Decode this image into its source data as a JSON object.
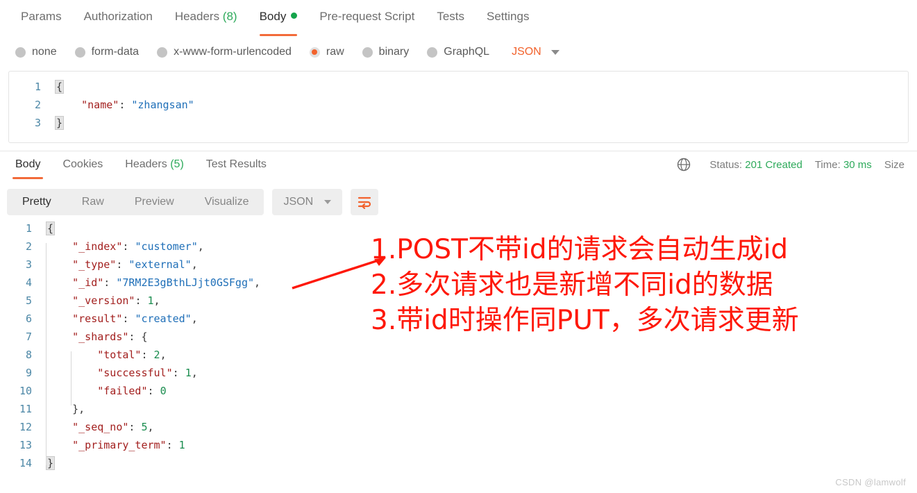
{
  "request_tabs": [
    {
      "label": "Params",
      "count": "",
      "active": false,
      "dot": false
    },
    {
      "label": "Authorization",
      "count": "",
      "active": false,
      "dot": false
    },
    {
      "label": "Headers",
      "count": "(8)",
      "active": false,
      "dot": false
    },
    {
      "label": "Body",
      "count": "",
      "active": true,
      "dot": true
    },
    {
      "label": "Pre-request Script",
      "count": "",
      "active": false,
      "dot": false
    },
    {
      "label": "Tests",
      "count": "",
      "active": false,
      "dot": false
    },
    {
      "label": "Settings",
      "count": "",
      "active": false,
      "dot": false
    }
  ],
  "body_types": {
    "options": [
      {
        "label": "none",
        "selected": false
      },
      {
        "label": "form-data",
        "selected": false
      },
      {
        "label": "x-www-form-urlencoded",
        "selected": false
      },
      {
        "label": "raw",
        "selected": true
      },
      {
        "label": "binary",
        "selected": false
      },
      {
        "label": "GraphQL",
        "selected": false
      }
    ],
    "format": "JSON",
    "format_color": "#f2622c"
  },
  "request_body": {
    "lines": [
      {
        "n": "1",
        "tokens": [
          {
            "t": "{",
            "c": "brace"
          }
        ]
      },
      {
        "n": "2",
        "tokens": [
          {
            "t": "    ",
            "c": "punc"
          },
          {
            "t": "\"name\"",
            "c": "key"
          },
          {
            "t": ": ",
            "c": "punc"
          },
          {
            "t": "\"zhangsan\"",
            "c": "str"
          }
        ]
      },
      {
        "n": "3",
        "tokens": [
          {
            "t": "}",
            "c": "brace"
          }
        ]
      }
    ]
  },
  "response_tabs": [
    {
      "label": "Body",
      "count": "",
      "active": true
    },
    {
      "label": "Cookies",
      "count": "",
      "active": false
    },
    {
      "label": "Headers",
      "count": "(5)",
      "active": false
    },
    {
      "label": "Test Results",
      "count": "",
      "active": false
    }
  ],
  "response_status": {
    "status_label": "Status:",
    "status_value": "201 Created",
    "time_label": "Time:",
    "time_value": "30 ms",
    "size_label": "Size",
    "globe_icon": "globe-icon"
  },
  "response_toolbar": {
    "views": [
      {
        "label": "Pretty",
        "active": true
      },
      {
        "label": "Raw",
        "active": false
      },
      {
        "label": "Preview",
        "active": false
      },
      {
        "label": "Visualize",
        "active": false
      }
    ],
    "format": "JSON",
    "wrap_icon": "word-wrap-icon"
  },
  "response_body": {
    "lines": [
      {
        "n": "1",
        "tokens": [
          {
            "t": "{",
            "c": "brace"
          }
        ]
      },
      {
        "n": "2",
        "tokens": [
          {
            "t": "    ",
            "c": "punc"
          },
          {
            "t": "\"_index\"",
            "c": "key"
          },
          {
            "t": ": ",
            "c": "punc"
          },
          {
            "t": "\"customer\"",
            "c": "str"
          },
          {
            "t": ",",
            "c": "punc"
          }
        ]
      },
      {
        "n": "3",
        "tokens": [
          {
            "t": "    ",
            "c": "punc"
          },
          {
            "t": "\"_type\"",
            "c": "key"
          },
          {
            "t": ": ",
            "c": "punc"
          },
          {
            "t": "\"external\"",
            "c": "str"
          },
          {
            "t": ",",
            "c": "punc"
          }
        ]
      },
      {
        "n": "4",
        "tokens": [
          {
            "t": "    ",
            "c": "punc"
          },
          {
            "t": "\"_id\"",
            "c": "key"
          },
          {
            "t": ": ",
            "c": "punc"
          },
          {
            "t": "\"7RM2E3gBthLJjt0GSFgg\"",
            "c": "str"
          },
          {
            "t": ",",
            "c": "punc"
          }
        ]
      },
      {
        "n": "5",
        "tokens": [
          {
            "t": "    ",
            "c": "punc"
          },
          {
            "t": "\"_version\"",
            "c": "key"
          },
          {
            "t": ": ",
            "c": "punc"
          },
          {
            "t": "1",
            "c": "num"
          },
          {
            "t": ",",
            "c": "punc"
          }
        ]
      },
      {
        "n": "6",
        "tokens": [
          {
            "t": "    ",
            "c": "punc"
          },
          {
            "t": "\"result\"",
            "c": "key"
          },
          {
            "t": ": ",
            "c": "punc"
          },
          {
            "t": "\"created\"",
            "c": "str"
          },
          {
            "t": ",",
            "c": "punc"
          }
        ]
      },
      {
        "n": "7",
        "tokens": [
          {
            "t": "    ",
            "c": "punc"
          },
          {
            "t": "\"_shards\"",
            "c": "key"
          },
          {
            "t": ": {",
            "c": "punc"
          }
        ]
      },
      {
        "n": "8",
        "tokens": [
          {
            "t": "        ",
            "c": "punc"
          },
          {
            "t": "\"total\"",
            "c": "key"
          },
          {
            "t": ": ",
            "c": "punc"
          },
          {
            "t": "2",
            "c": "num"
          },
          {
            "t": ",",
            "c": "punc"
          }
        ]
      },
      {
        "n": "9",
        "tokens": [
          {
            "t": "        ",
            "c": "punc"
          },
          {
            "t": "\"successful\"",
            "c": "key"
          },
          {
            "t": ": ",
            "c": "punc"
          },
          {
            "t": "1",
            "c": "num"
          },
          {
            "t": ",",
            "c": "punc"
          }
        ]
      },
      {
        "n": "10",
        "tokens": [
          {
            "t": "        ",
            "c": "punc"
          },
          {
            "t": "\"failed\"",
            "c": "key"
          },
          {
            "t": ": ",
            "c": "punc"
          },
          {
            "t": "0",
            "c": "num"
          }
        ]
      },
      {
        "n": "11",
        "tokens": [
          {
            "t": "    },",
            "c": "punc"
          }
        ]
      },
      {
        "n": "12",
        "tokens": [
          {
            "t": "    ",
            "c": "punc"
          },
          {
            "t": "\"_seq_no\"",
            "c": "key"
          },
          {
            "t": ": ",
            "c": "punc"
          },
          {
            "t": "5",
            "c": "num"
          },
          {
            "t": ",",
            "c": "punc"
          }
        ]
      },
      {
        "n": "13",
        "tokens": [
          {
            "t": "    ",
            "c": "punc"
          },
          {
            "t": "\"_primary_term\"",
            "c": "key"
          },
          {
            "t": ": ",
            "c": "punc"
          },
          {
            "t": "1",
            "c": "num"
          }
        ]
      },
      {
        "n": "14",
        "tokens": [
          {
            "t": "}",
            "c": "brace"
          }
        ]
      }
    ]
  },
  "annotation": {
    "color": "#fe1809",
    "lines": [
      "1.POST不带id的请求会自动生成id",
      "2.多次请求也是新增不同id的数据",
      "3.带id时操作同PUT，多次请求更新"
    ]
  },
  "watermark": "CSDN @lamwolf"
}
